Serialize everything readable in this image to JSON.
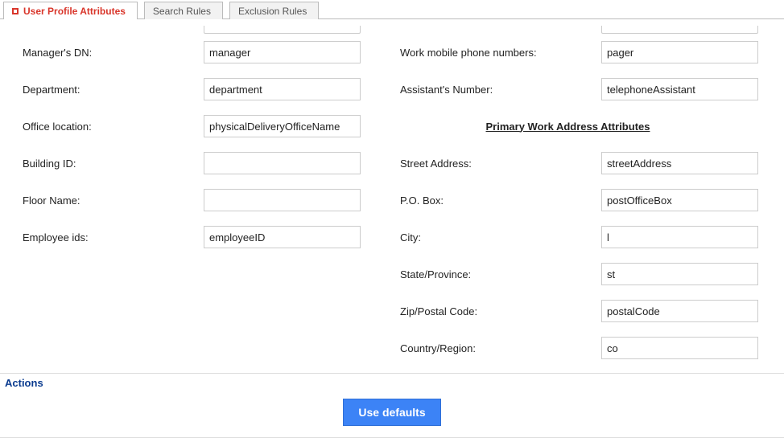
{
  "tabs": {
    "user_profile": "User Profile Attributes",
    "search_rules": "Search Rules",
    "exclusion_rules": "Exclusion Rules"
  },
  "left": {
    "managers_dn": {
      "label": "Manager's DN:",
      "value": "manager"
    },
    "department": {
      "label": "Department:",
      "value": "department"
    },
    "office_location": {
      "label": "Office location:",
      "value": "physicalDeliveryOfficeName"
    },
    "building_id": {
      "label": "Building ID:",
      "value": ""
    },
    "floor_name": {
      "label": "Floor Name:",
      "value": ""
    },
    "employee_ids": {
      "label": "Employee ids:",
      "value": "employeeID"
    }
  },
  "right": {
    "work_mobile": {
      "label": "Work mobile phone numbers:",
      "value": "pager"
    },
    "assistant_number": {
      "label": "Assistant's Number:",
      "value": "telephoneAssistant"
    },
    "section_title": "Primary Work Address Attributes",
    "street_address": {
      "label": "Street Address:",
      "value": "streetAddress"
    },
    "po_box": {
      "label": "P.O. Box:",
      "value": "postOfficeBox"
    },
    "city": {
      "label": "City:",
      "value": "l"
    },
    "state": {
      "label": "State/Province:",
      "value": "st"
    },
    "zip": {
      "label": "Zip/Postal Code:",
      "value": "postalCode"
    },
    "country": {
      "label": "Country/Region:",
      "value": "co"
    }
  },
  "actions": {
    "heading": "Actions",
    "use_defaults": "Use defaults"
  }
}
